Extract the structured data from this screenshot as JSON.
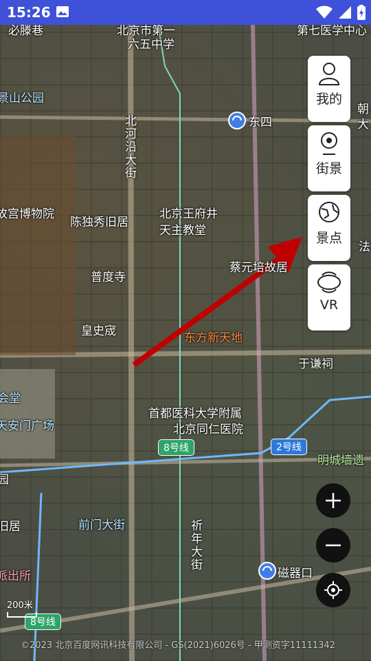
{
  "status_bar": {
    "time": "15:26",
    "icons": [
      "image-icon",
      "wifi-icon",
      "cellular-signal-icon",
      "battery-icon"
    ]
  },
  "map_labels": {
    "bizong": "必滕巷",
    "north_school": "北京市第一",
    "liuwu": "六五中学",
    "top_right": "第七医学中心",
    "jingshan": "景山公园",
    "chao": "朝",
    "da": "大",
    "dongsi": "东四",
    "heyan": "北河沿大街",
    "gugong": "故宫博物院",
    "chenduxiu": "陈独秀旧居",
    "wangfujing1": "北京王府井",
    "wangfujing2": "天主教堂",
    "fa": "法",
    "pudu": "普度寺",
    "caiyuan": "蔡元培故居",
    "huangshi": "皇史宬",
    "dongfang": "东方新天地",
    "yuqian": "于谦祠",
    "huitang": "会堂",
    "tiananmen": "天安门广场",
    "shoudu": "首都医科大学附属",
    "tongren": "北京同仁医院",
    "line8": "8号线",
    "line2": "2号线",
    "mingcheng": "明城墙遗",
    "yuan": "园",
    "qianmen": "前门大街",
    "jiu": "旧居",
    "xinjie": "祈年大街",
    "paichusuo": "派出所",
    "ciqikou": "磁器口",
    "line8b": "8号线"
  },
  "side_buttons": {
    "mine": "我的",
    "street_view": "街景",
    "scenic": "景点",
    "vr": "VR"
  },
  "zoom": {
    "in": "+",
    "out": "−"
  },
  "scale_label": "200米",
  "attribution": "©2023 北京百度网讯科技有限公司 - GS(2021)6026号 - 甲测资字11111342"
}
